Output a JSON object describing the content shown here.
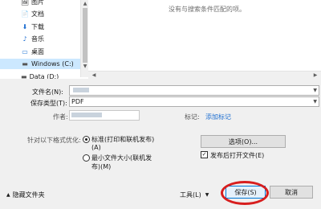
{
  "nav": {
    "items": [
      {
        "icon": "pictures-icon",
        "glyph": "🖼",
        "label": "图片"
      },
      {
        "icon": "documents-icon",
        "glyph": "📄",
        "label": "文档"
      },
      {
        "icon": "downloads-icon",
        "glyph": "⬇",
        "label": "下载"
      },
      {
        "icon": "music-icon",
        "glyph": "♪",
        "label": "音乐"
      },
      {
        "icon": "desktop-icon",
        "glyph": "▭",
        "label": "桌面"
      },
      {
        "icon": "drive-icon",
        "glyph": "▬",
        "label": "Windows (C:)"
      }
    ],
    "partial_item": "Data (D:)"
  },
  "file_pane": {
    "empty_message": "没有与搜索条件匹配的项。"
  },
  "form": {
    "filename_label": "文件名(N):",
    "filename_value": "",
    "filetype_label": "保存类型(T):",
    "filetype_value": "PDF",
    "author_label": "作者:",
    "author_value": "",
    "tags_label": "标记:",
    "tags_link": "添加标记",
    "optimize_label": "针对以下格式优化:",
    "option_standard_line1": "标准(打印和联机发布)",
    "option_standard_line2": "(A)",
    "option_min_line1": "最小文件大小(联机发",
    "option_min_line2": "布)(M)",
    "options_button": "选项(O)...",
    "open_after_publish": "发布后打开文件(E)",
    "open_after_publish_checked": true,
    "optimize_selected": "standard"
  },
  "footer": {
    "hide_folders": "隐藏文件夹",
    "tools": "工具(L)",
    "save": "保存(S)",
    "cancel": "取消"
  },
  "colors": {
    "highlight": "#d71e1e",
    "link": "#1f6fd1",
    "selection": "#cce8ff"
  }
}
